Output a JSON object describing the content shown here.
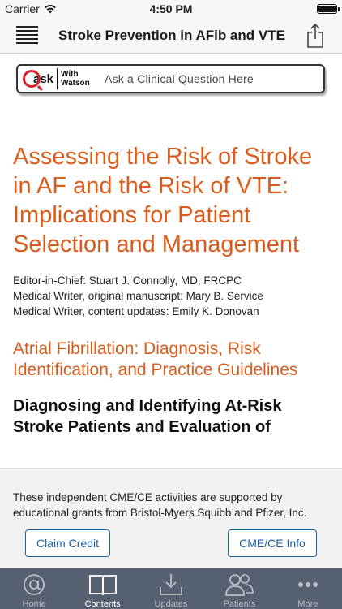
{
  "status_bar": {
    "carrier": "Carrier",
    "time": "4:50 PM",
    "battery_level": 1.0
  },
  "nav": {
    "title": "Stroke Prevention in AFib and VTE",
    "menu_icon": "hamburger-menu-icon",
    "share_icon": "share-icon"
  },
  "ask": {
    "logo_ask": "ask",
    "logo_with_watson_line1": "With",
    "logo_with_watson_line2": "Watson",
    "placeholder": "Ask a Clinical Question Here"
  },
  "document": {
    "title": "Assessing the Risk of Stroke in AF and the Risk of VTE: Implications for Patient Selection and Management",
    "credits": [
      "Editor-in-Chief: Stuart J. Connolly, MD, FRCPC",
      "Medical Writer, original manuscript: Mary B. Service",
      "Medical Writer, content updates: Emily K. Donovan"
    ],
    "section_heading": "Atrial Fibrillation: Diagnosis, Risk Identification, and Practice Guidelines",
    "sub_heading": "Diagnosing and Identifying At-Risk Stroke Patients and Evaluation of"
  },
  "cme": {
    "notice": "These independent CME/CE activities are supported by educational grants from Bristol-Myers Squibb and Pfizer, Inc.",
    "claim_label": "Claim Credit",
    "info_label": "CME/CE Info"
  },
  "tabs": [
    {
      "label": "Home",
      "icon": "at-sign-icon",
      "active": false
    },
    {
      "label": "Contents",
      "icon": "open-book-icon",
      "active": true
    },
    {
      "label": "Updates",
      "icon": "download-tray-icon",
      "active": false
    },
    {
      "label": "Patients",
      "icon": "patients-icon",
      "active": false
    },
    {
      "label": "More",
      "icon": "more-dots-icon",
      "active": false
    }
  ],
  "colors": {
    "accent_orange": "#d85d1c",
    "button_blue": "#1d5fa8",
    "tab_bar_bg": "#556070",
    "watson_red": "#d4242a"
  }
}
